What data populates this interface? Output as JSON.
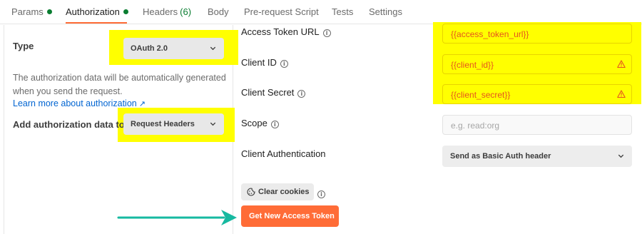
{
  "tabs": [
    {
      "label": "Params",
      "dot": true
    },
    {
      "label": "Authorization",
      "dot": true,
      "active": true
    },
    {
      "label": "Headers",
      "count": "(6)"
    },
    {
      "label": "Body"
    },
    {
      "label": "Pre-request Script"
    },
    {
      "label": "Tests"
    },
    {
      "label": "Settings"
    }
  ],
  "left": {
    "type_label": "Type",
    "type_value": "OAuth 2.0",
    "description": "The authorization data will be automatically generated when you send the request.",
    "learn_more": "Learn more about authorization",
    "learn_more_arrow": "↗",
    "add_to_label": "Add authorization data to",
    "add_to_value": "Request Headers"
  },
  "fields": {
    "access_token_url": {
      "label": "Access Token URL",
      "value": "{{access_token_url}}"
    },
    "client_id": {
      "label": "Client ID",
      "value": "{{client_id}}",
      "warning": true
    },
    "client_secret": {
      "label": "Client Secret",
      "value": "{{client_secret}}",
      "warning": true
    },
    "scope": {
      "label": "Scope",
      "placeholder": "e.g. read:org"
    },
    "client_authentication": {
      "label": "Client Authentication",
      "value": "Send as Basic Auth header"
    }
  },
  "info_glyph": "i",
  "buttons": {
    "clear_cookies": "Clear cookies",
    "get_token": "Get New Access Token"
  },
  "colors": {
    "accent": "#ff6c37",
    "highlight": "#ffff00",
    "variable_text": "#e6541e",
    "status_dot": "#0a7d31",
    "link": "#0265d2",
    "annotation_arrow": "#16b9a0"
  },
  "icons": {
    "status_dot": "green-dot-icon",
    "info": "info-circle-icon",
    "warning": "warning-triangle-icon",
    "chevron": "chevron-down-icon",
    "external": "external-link-arrow-icon",
    "cookie": "cookie-icon",
    "pointer": "annotation-arrow-icon"
  }
}
